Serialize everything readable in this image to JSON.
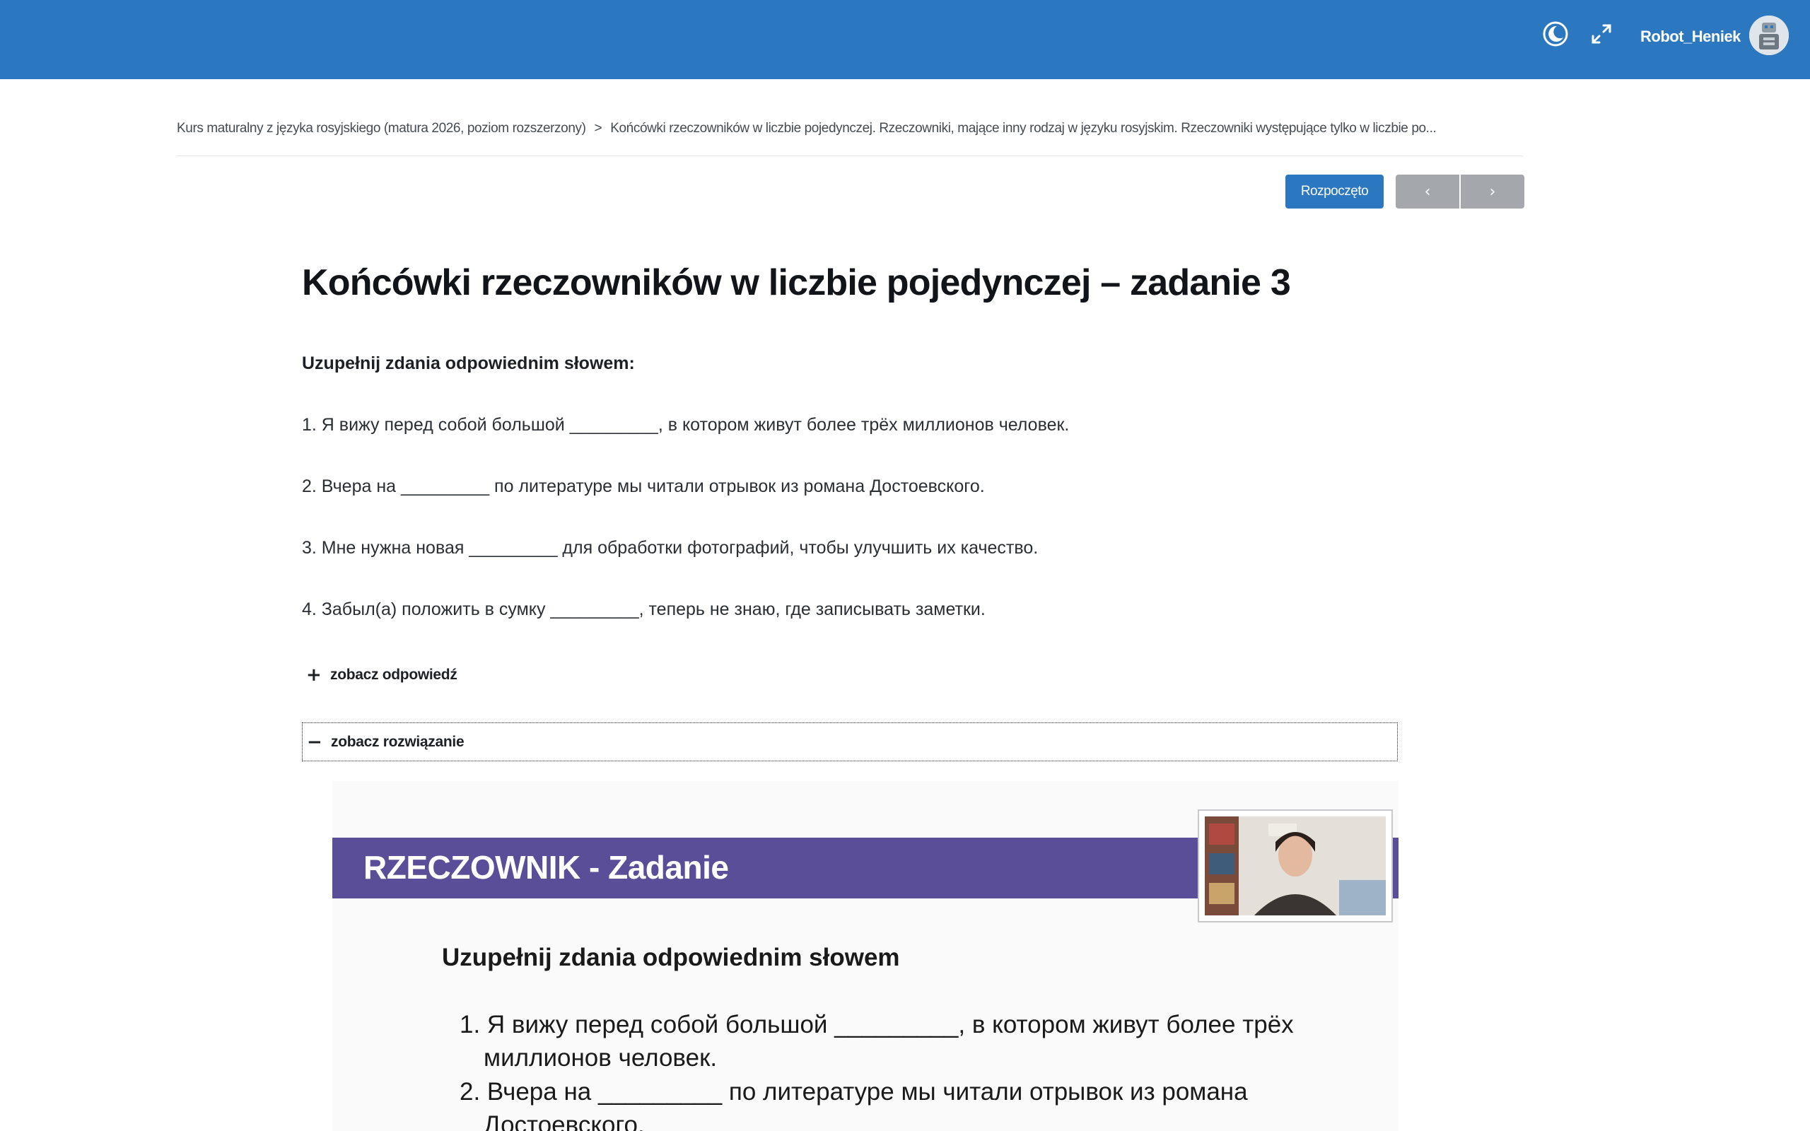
{
  "navbar": {
    "user_name": "Robot_Heniek",
    "icons": [
      "dark-mode-icon",
      "fullscreen-icon"
    ],
    "color": "#2b77c0"
  },
  "breadcrumb": {
    "course": "Kurs maturalny z języka rosyjskiego (matura 2026, poziom rozszerzony)",
    "separator": ">",
    "lesson": "Końcówki rzeczowników w liczbie pojedynczej. Rzeczowniki, mające inny rodzaj w języku rosyjskim. Rzeczowniki występujące tylko w liczbie po..."
  },
  "header": {
    "status_label": "Rozpoczęto",
    "prev_label": "‹",
    "next_label": "›"
  },
  "main": {
    "title": "Końcówki rzeczowników w liczbie pojedynczej – zadanie 3",
    "instruction": "Uzupełnij zdania odpowiednim słowem:",
    "sentences": [
      "1. Я вижу перед собой большой _________, в котором живут более трёх миллионов человек.",
      "2. Вчера на _________ по литературе мы читали отрывок из романа Достоевского.",
      "3. Мне нужна новая _________ для обработки фотографий, чтобы улучшить их качество.",
      "4. Забыл(а) положить в сумку _________, теперь не знаю, где записывать заметки."
    ],
    "show_answer": {
      "symbol": "+",
      "label": "zobacz odpowiedź"
    },
    "show_solution": {
      "symbol": "−",
      "label": "zobacz rozwiązanie"
    }
  },
  "video": {
    "slide_title": "RZECZOWNIK - Zadanie",
    "slide_instruction": "Uzupełnij zdania odpowiednim słowem",
    "lines": [
      "1. Я вижу перед собой большой _________, в котором живут более трёх",
      "миллионов человек.",
      "2. Вчера на _________ по литературе мы читали отрывок из романа",
      "Достоевского."
    ],
    "accent_color": "#5b4e99"
  }
}
